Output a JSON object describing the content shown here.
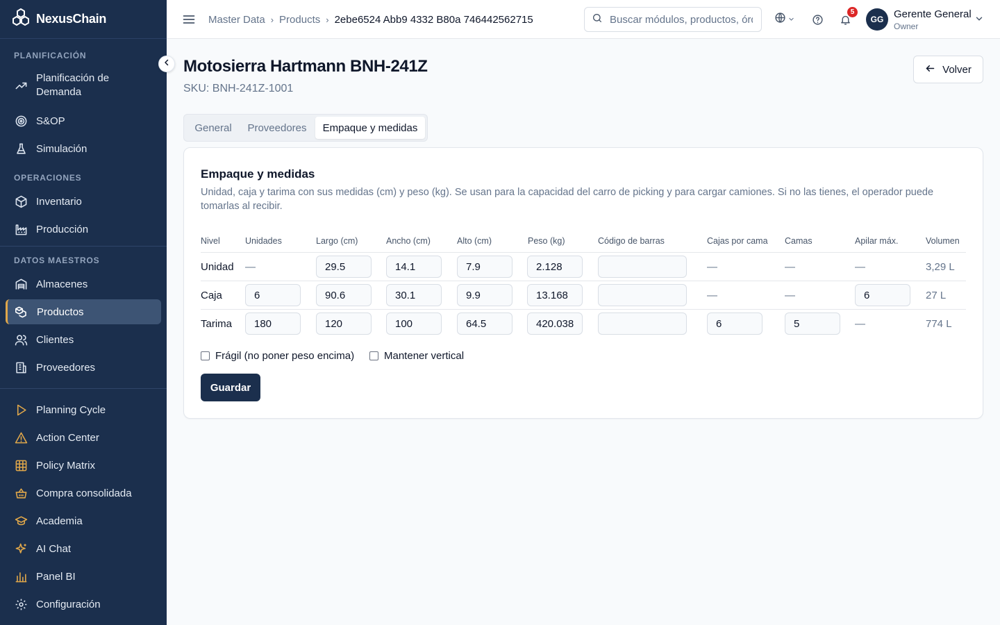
{
  "app": {
    "name": "NexusChain"
  },
  "sidebar": {
    "sections": [
      {
        "label": "PLANIFICACIÓN"
      },
      {
        "label": "OPERACIONES"
      },
      {
        "label": "DATOS MAESTROS"
      }
    ],
    "items": [
      {
        "label_line1": "Planificación de",
        "label_line2": "Demanda",
        "icon": "trending-up-icon"
      },
      {
        "label": "S&OP",
        "icon": "target-icon"
      },
      {
        "label": "Simulación",
        "icon": "flask-icon"
      },
      {
        "label": "Inventario",
        "icon": "package-icon"
      },
      {
        "label": "Producción",
        "icon": "factory-icon"
      },
      {
        "label": "Almacenes",
        "icon": "warehouse-icon"
      },
      {
        "label": "Productos",
        "icon": "boxes-icon",
        "active": true
      },
      {
        "label": "Clientes",
        "icon": "users-icon"
      },
      {
        "label": "Proveedores",
        "icon": "building-icon"
      },
      {
        "label": "Planning Cycle",
        "icon": "play-icon"
      },
      {
        "label": "Action Center",
        "icon": "alert-triangle-icon"
      },
      {
        "label": "Policy Matrix",
        "icon": "grid-icon"
      },
      {
        "label": "Compra consolidada",
        "icon": "basket-icon"
      },
      {
        "label": "Academia",
        "icon": "graduation-cap-icon"
      },
      {
        "label": "AI Chat",
        "icon": "sparkles-icon"
      },
      {
        "label": "Panel BI",
        "icon": "bar-chart-icon"
      },
      {
        "label": "Configuración",
        "icon": "gear-icon"
      }
    ],
    "accent_color": "#e0a74a"
  },
  "topbar": {
    "breadcrumb": [
      "Master Data",
      "Products",
      "2ebe6524 Abb9 4332 B80a 746442562715"
    ],
    "search_placeholder": "Buscar módulos, productos, órdenes...",
    "notification_count": "5",
    "user": {
      "initials": "GG",
      "name": "Gerente General",
      "role": "Owner"
    }
  },
  "product": {
    "title": "Motosierra Hartmann BNH-241Z",
    "sku": "SKU: BNH-241Z-1001",
    "back_label": "Volver"
  },
  "tabs": [
    "General",
    "Proveedores",
    "Empaque y medidas"
  ],
  "active_tab": "Empaque y medidas",
  "packaging": {
    "title": "Empaque y medidas",
    "description": "Unidad, caja y tarima con sus medidas (cm) y peso (kg). Se usan para la capacidad del carro de picking y para cargar camiones. Si no las tienes, el operador puede tomarlas al recibir.",
    "columns": [
      "Nivel",
      "Unidades",
      "Largo (cm)",
      "Ancho (cm)",
      "Alto (cm)",
      "Peso (kg)",
      "Código de barras",
      "Cajas por cama",
      "Camas",
      "Apilar máx.",
      "Volumen"
    ],
    "rows": [
      {
        "level": "Unidad",
        "units": "—",
        "length": "29.5",
        "width": "14.1",
        "height": "7.9",
        "weight": "2.128",
        "barcode": "",
        "boxes_per_layer": "—",
        "layers": "—",
        "stack_max": "—",
        "volume": "3,29 L"
      },
      {
        "level": "Caja",
        "units": "6",
        "length": "90.6",
        "width": "30.1",
        "height": "9.9",
        "weight": "13.168",
        "barcode": "",
        "boxes_per_layer": "—",
        "layers": "—",
        "stack_max": "6",
        "volume": "27 L"
      },
      {
        "level": "Tarima",
        "units": "180",
        "length": "120",
        "width": "100",
        "height": "64.5",
        "weight": "420.038",
        "barcode": "",
        "boxes_per_layer": "6",
        "layers": "5",
        "stack_max": "—",
        "volume": "774 L"
      }
    ],
    "fragile_label": "Frágil (no poner peso encima)",
    "fragile_checked": false,
    "vertical_label": "Mantener vertical",
    "vertical_checked": false,
    "save_label": "Guardar"
  },
  "colors": {
    "sidebar_bg": "#1b2f4d",
    "primary": "#1b2f4d",
    "badge": "#dc2626"
  }
}
